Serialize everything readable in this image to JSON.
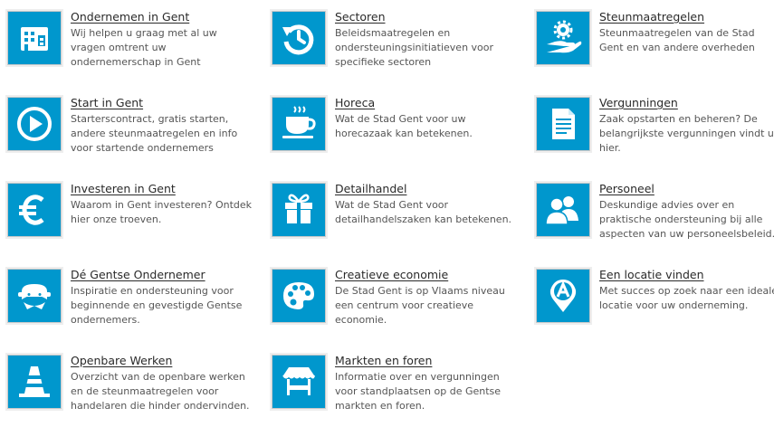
{
  "theme": {
    "tile_color": "#0097cd",
    "icon_color": "#ffffff"
  },
  "tiles": [
    {
      "title": "Ondernemen in Gent",
      "desc": "Wij helpen u graag met al uw vragen omtrent uw ondernemerschap in Gent",
      "icon": "office-building-icon"
    },
    {
      "title": "Sectoren",
      "desc": "Beleidsmaatregelen en ondersteuningsinitiatieven voor specifieke sectoren",
      "icon": "history-arrow-icon"
    },
    {
      "title": "Steunmaatregelen",
      "desc": "Steunmaatregelen van de Stad Gent en van andere overheden",
      "icon": "hand-gear-icon"
    },
    {
      "title": "Start in Gent",
      "desc": "Starterscontract, gratis starten, andere steunmaatregelen en info voor startende ondernemers",
      "icon": "play-circle-icon"
    },
    {
      "title": "Horeca",
      "desc": "Wat de Stad Gent voor uw horecazaak kan betekenen.",
      "icon": "coffee-cup-icon"
    },
    {
      "title": "Vergunningen",
      "desc": "Zaak opstarten en beheren? De belangrijkste vergunningen vindt u hier.",
      "icon": "document-icon"
    },
    {
      "title": "Investeren in Gent",
      "desc": "Waarom in Gent investeren? Ontdek hier onze troeven.",
      "icon": "euro-icon"
    },
    {
      "title": "Detailhandel",
      "desc": "Wat de Stad Gent voor detailhandelszaken kan betekenen.",
      "icon": "gift-icon"
    },
    {
      "title": "Personeel",
      "desc": "Deskundige advies over en praktische ondersteuning bij alle aspecten van uw personeelsbeleid.",
      "icon": "people-icon"
    },
    {
      "title": "Dé Gentse Ondernemer",
      "desc": "Inspiratie en ondersteuning voor beginnende en gevestigde Gentse ondernemers.",
      "icon": "masked-figure-icon"
    },
    {
      "title": "Creatieve economie",
      "desc": "De Stad Gent is op Vlaams niveau een centrum voor creatieve economie.",
      "icon": "palette-icon"
    },
    {
      "title": "Een locatie vinden",
      "desc": "Met succes op zoek naar een ideale locatie voor uw onderneming.",
      "icon": "location-pin-icon"
    },
    {
      "title": "Openbare Werken",
      "desc": "Overzicht van de openbare werken en de steunmaatregelen voor handelaren die hinder ondervinden.",
      "icon": "traffic-cone-icon"
    },
    {
      "title": "Markten en foren",
      "desc": "Informatie over en vergunningen voor standplaatsen op de Gentse markten en foren.",
      "icon": "market-stall-icon"
    }
  ]
}
